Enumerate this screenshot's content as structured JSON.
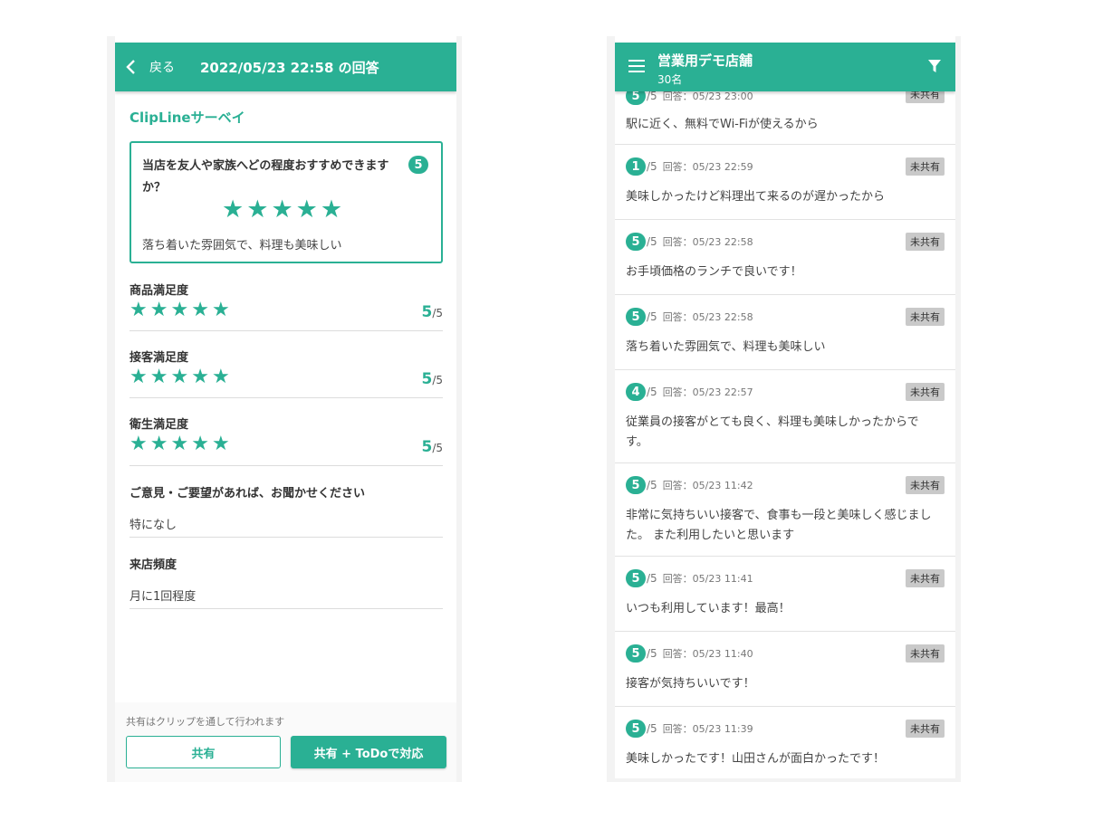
{
  "left": {
    "header": {
      "back_label": "戻る",
      "title": "2022/05/23 22:58 の回答"
    },
    "survey_name": "ClipLineサーベイ",
    "highlight": {
      "question": "当店を友人や家族へどの程度おすすめできますか？",
      "score": "5",
      "stars": 5,
      "comment": "落ち着いた雰囲気で、料理も美味しい"
    },
    "ratings": [
      {
        "label": "商品満足度",
        "score": "5",
        "max": "/5",
        "stars": 5
      },
      {
        "label": "接客満足度",
        "score": "5",
        "max": "/5",
        "stars": 5
      },
      {
        "label": "衛生満足度",
        "score": "5",
        "max": "/5",
        "stars": 5
      }
    ],
    "text_questions": [
      {
        "label": "ご意見・ご要望があれば、お聞かせください",
        "answer": "特になし"
      },
      {
        "label": "来店頻度",
        "answer": "月に1回程度"
      }
    ],
    "footer": {
      "note": "共有はクリップを通して行われます",
      "share_button": "共有",
      "share_todo_button": "共有 + ToDoで対応"
    }
  },
  "right": {
    "header": {
      "store_name": "営業用デモ店舗",
      "count": "30名"
    },
    "responses": [
      {
        "score": "5",
        "max": "/5",
        "date": "回答：05/23 23:00",
        "tag": "未共有",
        "comment": "駅に近く、無料でWi-Fiが使えるから"
      },
      {
        "score": "1",
        "max": "/5",
        "date": "回答：05/23 22:59",
        "tag": "未共有",
        "comment": "美味しかったけど料理出て来るのが遅かったから"
      },
      {
        "score": "5",
        "max": "/5",
        "date": "回答：05/23 22:58",
        "tag": "未共有",
        "comment": "お手頃価格のランチで良いです！"
      },
      {
        "score": "5",
        "max": "/5",
        "date": "回答：05/23 22:58",
        "tag": "未共有",
        "comment": "落ち着いた雰囲気で、料理も美味しい"
      },
      {
        "score": "4",
        "max": "/5",
        "date": "回答：05/23 22:57",
        "tag": "未共有",
        "comment": "従業員の接客がとても良く、料理も美味しかったからです。"
      },
      {
        "score": "5",
        "max": "/5",
        "date": "回答：05/23 11:42",
        "tag": "未共有",
        "comment": "非常に気持ちいい接客で、食事も一段と美味しく感じました。 また利用したいと思います"
      },
      {
        "score": "5",
        "max": "/5",
        "date": "回答：05/23 11:41",
        "tag": "未共有",
        "comment": "いつも利用しています！最高！"
      },
      {
        "score": "5",
        "max": "/5",
        "date": "回答：05/23 11:40",
        "tag": "未共有",
        "comment": "接客が気持ちいいです！"
      },
      {
        "score": "5",
        "max": "/5",
        "date": "回答：05/23 11:39",
        "tag": "未共有",
        "comment": "美味しかったです！山田さんが面白かったです！"
      }
    ]
  },
  "colors": {
    "accent": "#2ab094",
    "tag_bg": "#c9c9c9"
  },
  "icons": {
    "back": "chevron-left-icon",
    "menu": "hamburger-menu-icon",
    "filter": "filter-icon",
    "star": "star-icon"
  }
}
